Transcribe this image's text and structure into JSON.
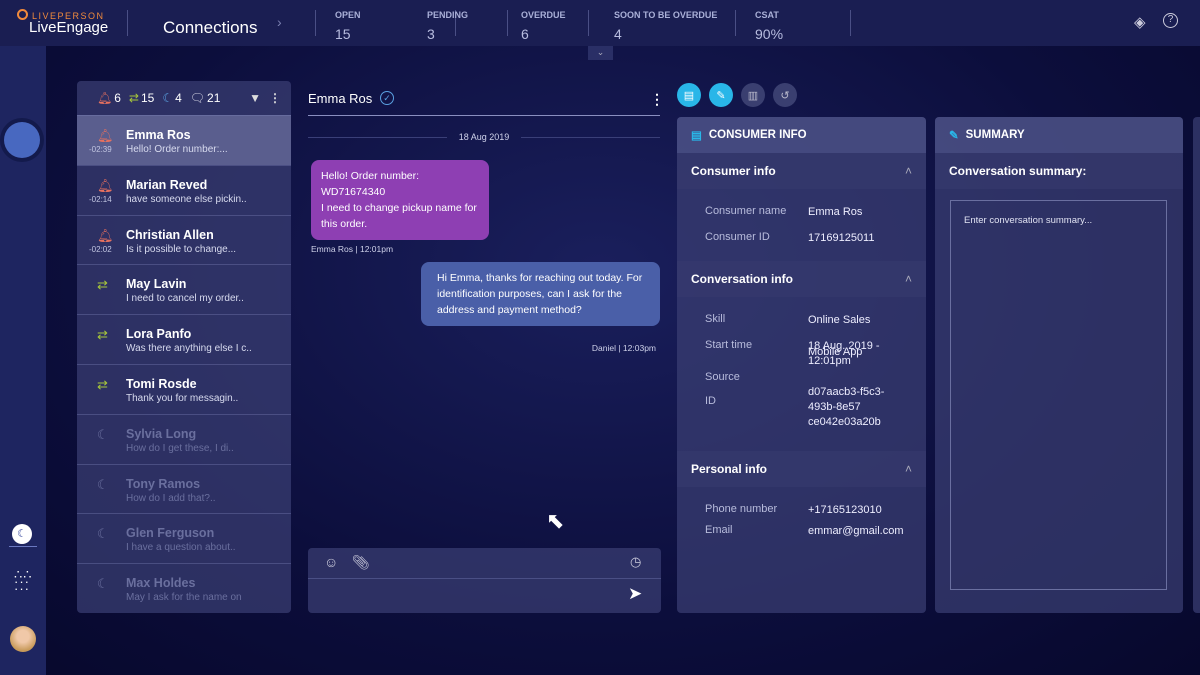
{
  "header": {
    "brand_small": "LIVEPERSON",
    "brand": "LiveEngage",
    "title": "Connections",
    "stats": [
      {
        "label": "OPEN",
        "value": "15"
      },
      {
        "label": "PENDING",
        "value": "3"
      },
      {
        "label": "OVERDUE",
        "value": "6"
      },
      {
        "label": "SOON TO BE OVERDUE",
        "value": "4"
      },
      {
        "label": "CSAT",
        "value": "90%"
      }
    ]
  },
  "list": {
    "counts": {
      "alerts": "6",
      "transfers": "15",
      "away": "4",
      "closed": "21"
    },
    "items": [
      {
        "name": "Emma Ros",
        "preview": "Hello! Order number:...",
        "time": "-02:39",
        "icon": "bell",
        "state": "selected"
      },
      {
        "name": "Marian Reved",
        "preview": "have someone else pickin..",
        "time": "-02:14",
        "icon": "bell",
        "state": "active"
      },
      {
        "name": "Christian Allen",
        "preview": "Is it possible to change...",
        "time": "-02:02",
        "icon": "bell",
        "state": "active"
      },
      {
        "name": "May Lavin",
        "preview": "I need to cancel my order..",
        "icon": "transfer",
        "state": "active"
      },
      {
        "name": "Lora Panfo",
        "preview": "Was there anything else I c..",
        "icon": "transfer",
        "state": "active"
      },
      {
        "name": "Tomi Rosde",
        "preview": "Thank you for messagin..",
        "icon": "transfer",
        "state": "active"
      },
      {
        "name": "Sylvia Long",
        "preview": "How do I get these, I di..",
        "icon": "moon",
        "state": "dim"
      },
      {
        "name": "Tony Ramos",
        "preview": "How do I add that?..",
        "icon": "moon",
        "state": "dim"
      },
      {
        "name": "Glen Ferguson",
        "preview": "I have a question about..",
        "icon": "moon",
        "state": "dim"
      },
      {
        "name": "Max Holdes",
        "preview": "May I ask for the name on",
        "icon": "moon",
        "state": "dim"
      }
    ]
  },
  "chat": {
    "name": "Emma Ros",
    "date": "18 Aug 2019",
    "messages": [
      {
        "text": "Hello! Order number: WD71674340\nI need to change pickup name for this order.",
        "meta": "Emma Ros | 12:01pm",
        "from": "consumer",
        "color": "#8e3fb3"
      },
      {
        "text": "Hi Emma, thanks for reaching out today. For identification purposes, can I ask for the address and payment method?",
        "meta": "Daniel | 12:03pm",
        "from": "agent",
        "color": "#4a5fa8"
      }
    ]
  },
  "consumer_panel": {
    "title": "CONSUMER INFO",
    "sections": [
      {
        "title": "Consumer info",
        "rows": [
          [
            "Consumer name",
            "Emma Ros"
          ],
          [
            "Consumer ID",
            "17169125011"
          ]
        ]
      },
      {
        "title": "Conversation info",
        "rows": [
          [
            "Skill",
            "Online Sales"
          ],
          [
            "Start time",
            "18 Aug. 2019 - 12:01pm"
          ],
          [
            "Source",
            "Mobile App"
          ],
          [
            "ID",
            "d07aacb3-f5c3-493b-8e57 ce042e03a20b"
          ]
        ]
      },
      {
        "title": "Personal info",
        "rows": [
          [
            "Phone number",
            "+17165123010"
          ],
          [
            "Email",
            "emmar@gmail.com"
          ]
        ]
      }
    ]
  },
  "summary_panel": {
    "title": "SUMMARY",
    "label": "Conversation summary:",
    "placeholder": "Enter conversation summary..."
  },
  "colors": {
    "accent": "#29b6e8",
    "alert": "#e5705f",
    "transfer": "#a8c83a",
    "away": "#5aa0e0"
  }
}
